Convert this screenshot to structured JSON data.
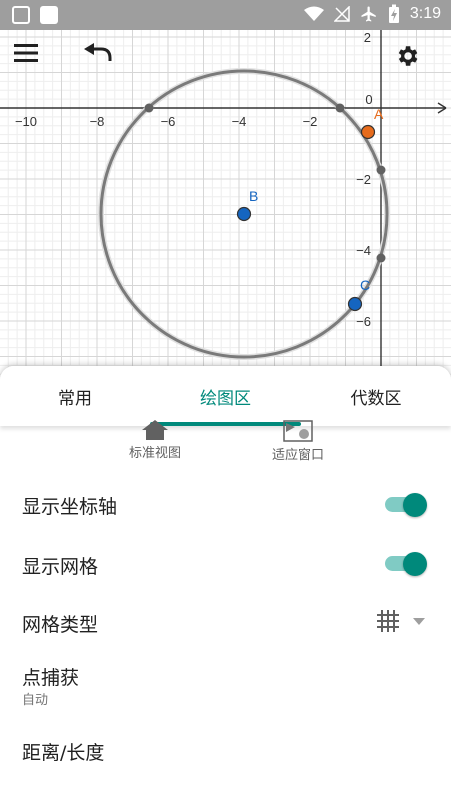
{
  "status_bar": {
    "time": "3:19"
  },
  "graph": {
    "axis_x_ticks": [
      "−10",
      "−8",
      "−6",
      "−4",
      "−2",
      "0"
    ],
    "axis_y_ticks": [
      "2",
      "−2",
      "−4",
      "−6"
    ],
    "points": [
      {
        "label": "A",
        "color": "#e66b1c"
      },
      {
        "label": "B",
        "color": "#1565c0"
      },
      {
        "label": "C",
        "color": "#1565c0"
      }
    ]
  },
  "tabs": [
    {
      "label": "常用"
    },
    {
      "label": "绘图区",
      "active": true
    },
    {
      "label": "代数区"
    }
  ],
  "quick_actions": {
    "standard_view": "标准视图",
    "fit_window": "适应窗口"
  },
  "settings": {
    "show_axes": {
      "label": "显示坐标轴",
      "on": true
    },
    "show_grid": {
      "label": "显示网格",
      "on": true
    },
    "grid_type": {
      "label": "网格类型"
    },
    "point_capture": {
      "label": "点捕获",
      "value": "自动"
    },
    "distance": {
      "label": "距离/长度"
    }
  },
  "colors": {
    "accent": "#00897b",
    "accent_light": "#80cbc4",
    "point_orange": "#e66b1c",
    "point_blue": "#1565c0"
  }
}
